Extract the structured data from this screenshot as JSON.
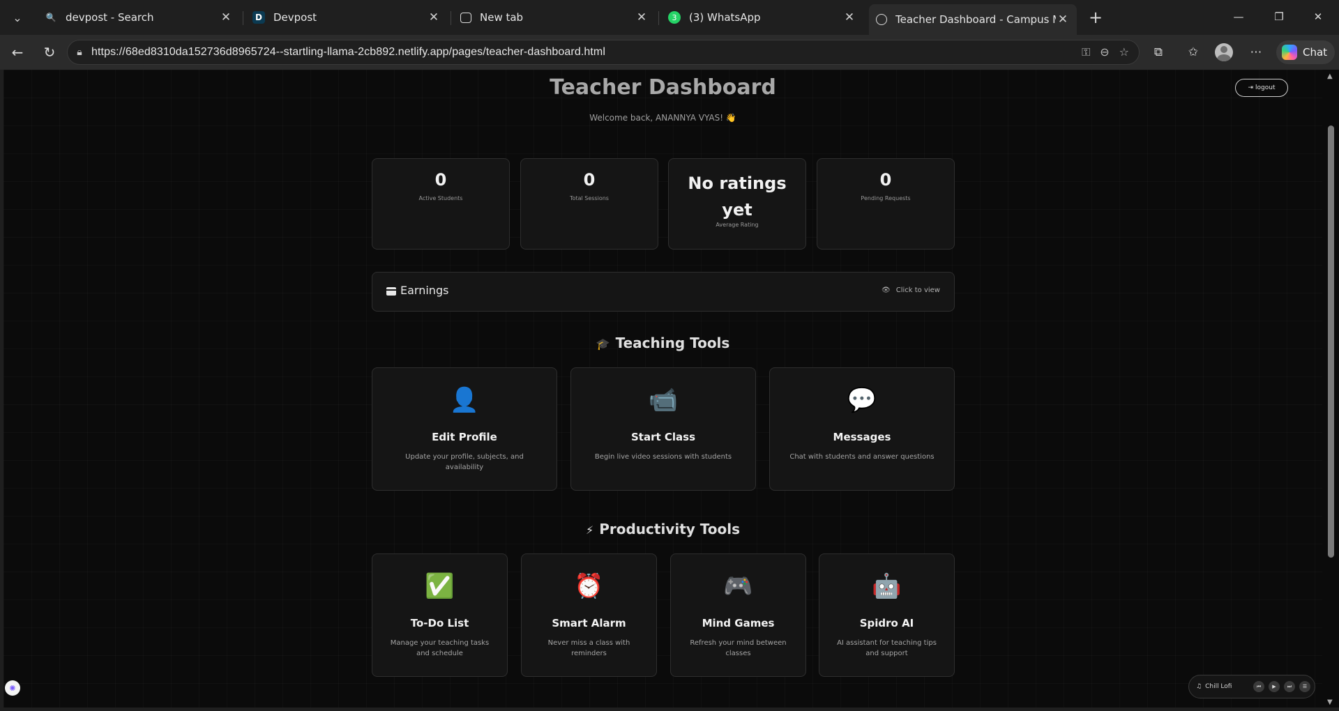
{
  "browser": {
    "tabs": [
      {
        "title": "devpost - Search",
        "favicon": "search-icon"
      },
      {
        "title": "Devpost",
        "favicon": "D"
      },
      {
        "title": "New tab",
        "favicon": "newtab-icon"
      },
      {
        "title": "(3) WhatsApp",
        "favicon": "3"
      },
      {
        "title": "Teacher Dashboard - Campus Mentor",
        "favicon": "globe-icon"
      }
    ],
    "url": "https://68ed8310da152736d8965724--startling-llama-2cb892.netlify.app/pages/teacher-dashboard.html",
    "chat_label": "Chat"
  },
  "header": {
    "title": "Teacher Dashboard",
    "welcome": "Welcome back, ANANNYA VYAS! 👋",
    "logout": "logout"
  },
  "stats": [
    {
      "value": "0",
      "label": "Active Students"
    },
    {
      "value": "0",
      "label": "Total Sessions"
    },
    {
      "value": "No ratings yet",
      "label": "Average Rating"
    },
    {
      "value": "0",
      "label": "Pending Requests"
    }
  ],
  "earnings": {
    "title": "Earnings",
    "action": "Click to view"
  },
  "teaching": {
    "heading": "Teaching Tools",
    "tools": [
      {
        "icon": "👤",
        "name": "Edit Profile",
        "desc": "Update your profile, subjects, and availability"
      },
      {
        "icon": "📹",
        "name": "Start Class",
        "desc": "Begin live video sessions with students"
      },
      {
        "icon": "💬",
        "name": "Messages",
        "desc": "Chat with students and answer questions"
      }
    ]
  },
  "productivity": {
    "heading": "Productivity Tools",
    "tools": [
      {
        "icon": "✅",
        "name": "To-Do List",
        "desc": "Manage your teaching tasks and schedule"
      },
      {
        "icon": "⏰",
        "name": "Smart Alarm",
        "desc": "Never miss a class with reminders"
      },
      {
        "icon": "🎮",
        "name": "Mind Games",
        "desc": "Refresh your mind between classes"
      },
      {
        "icon": "🤖",
        "name": "Spidro AI",
        "desc": "AI assistant for teaching tips and support"
      }
    ]
  },
  "music": {
    "label": "Chill Lofi"
  }
}
